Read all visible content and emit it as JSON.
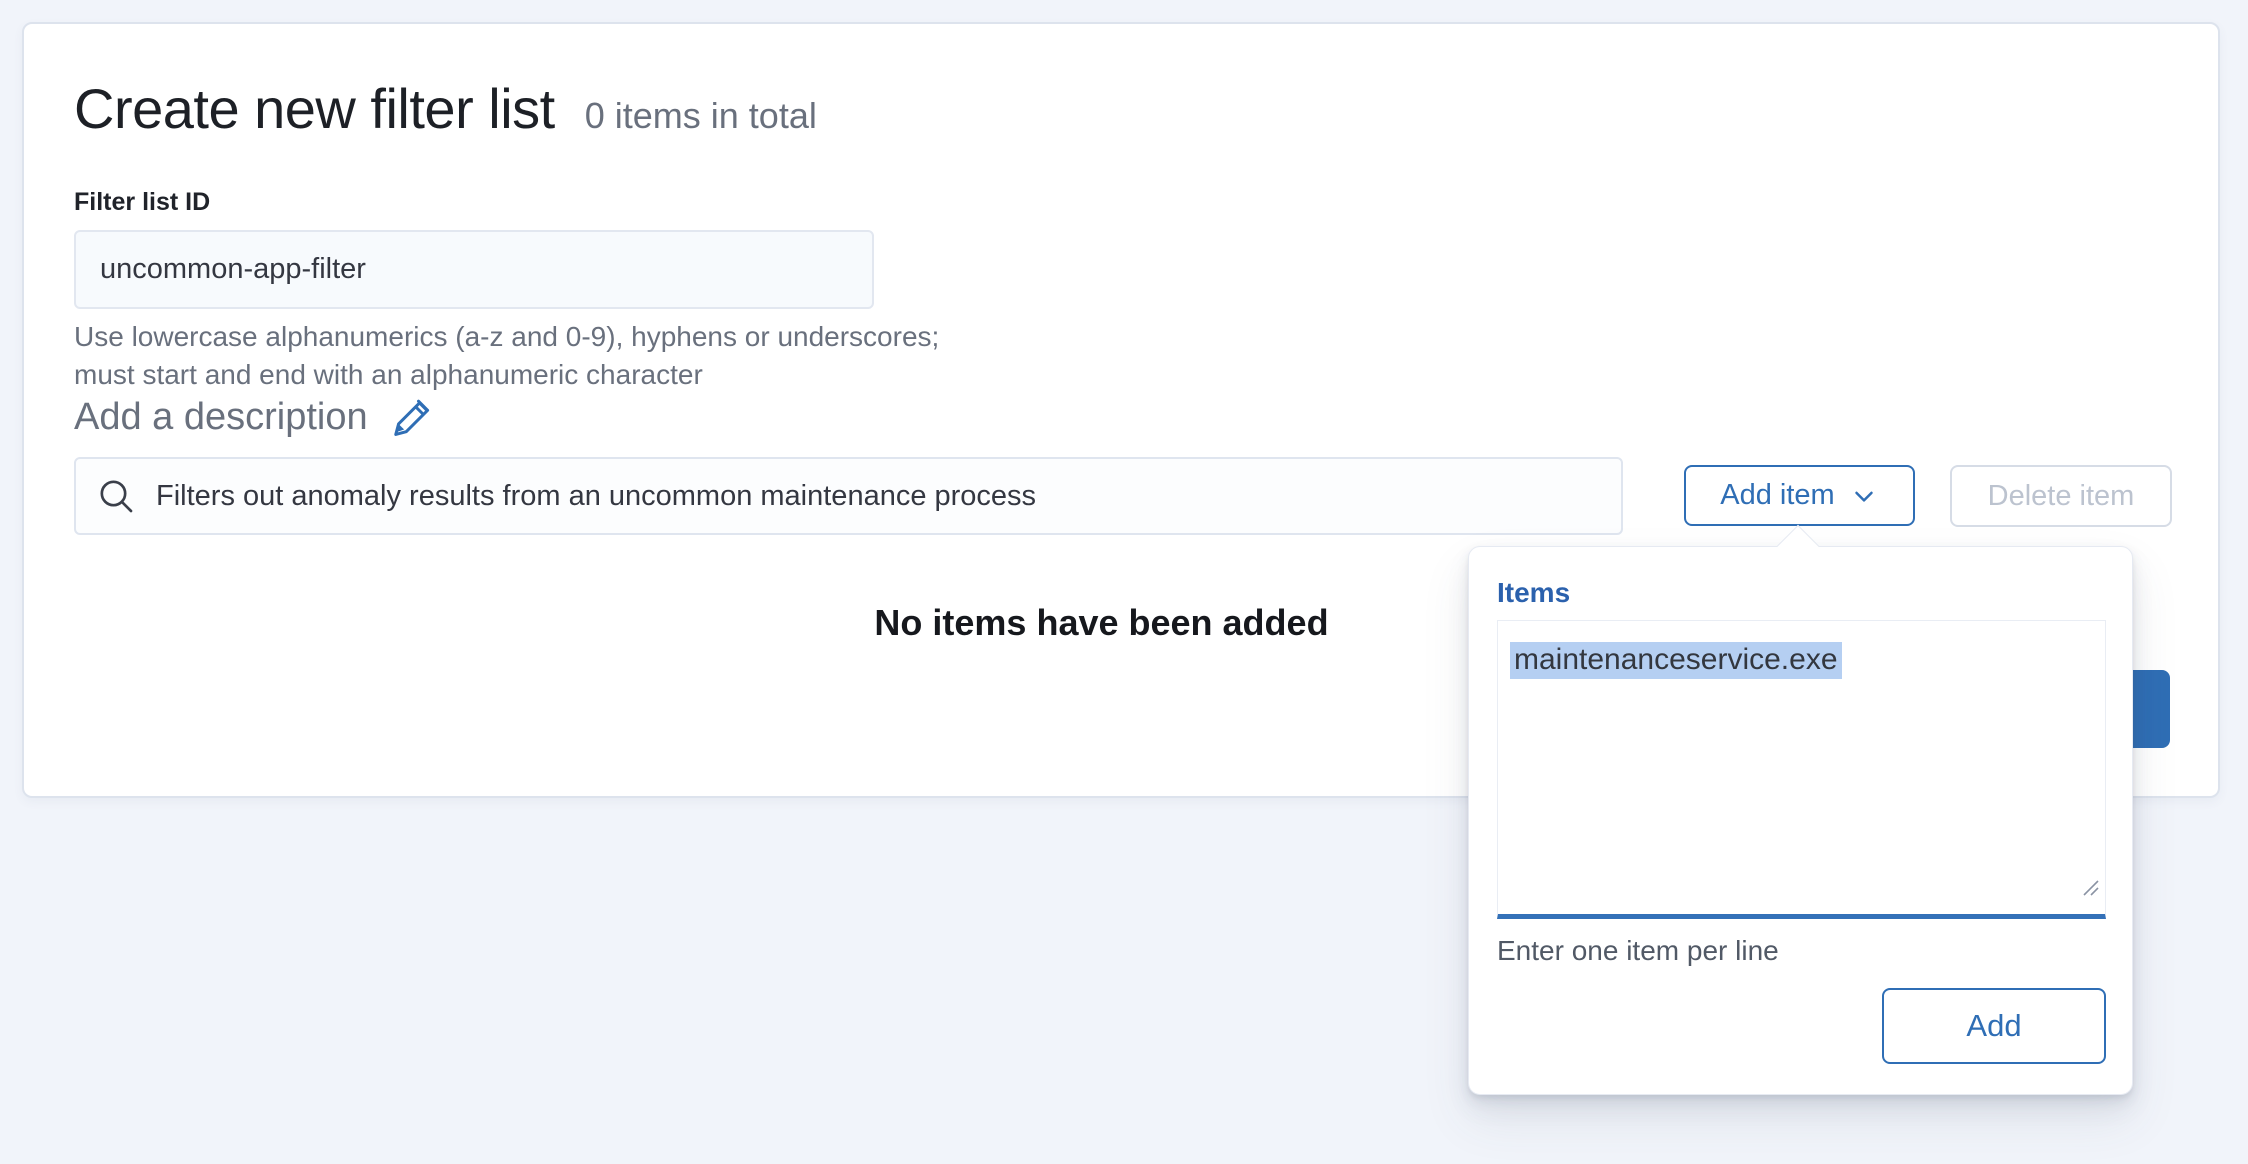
{
  "header": {
    "title": "Create new filter list",
    "items_count_text": "0 items in total"
  },
  "form": {
    "id_label": "Filter list ID",
    "id_value": "uncommon-app-filter",
    "id_help_line1": "Use lowercase alphanumerics (a-z and 0-9), hyphens or underscores;",
    "id_help_line2": "must start and end with an alphanumeric character",
    "description_link": "Add a description",
    "search_value": "Filters out anomaly results from an uncommon maintenance process"
  },
  "toolbar": {
    "add_item_label": "Add item",
    "delete_item_label": "Delete item"
  },
  "items_section": {
    "empty_message": "No items have been added"
  },
  "popover": {
    "label": "Items",
    "textarea_value": "maintenanceservice.exe",
    "help": "Enter one item per line",
    "add_button": "Add"
  },
  "icons": {
    "pencil": "pencil-edit",
    "search": "magnifier",
    "chevron": "chevron-down",
    "resize": "textarea-resize-handle"
  },
  "colors": {
    "primary_blue": "#2f6eb5",
    "selection_highlight": "#b5cff2",
    "subdued_text": "#69707d",
    "page_background": "#f1f4fa"
  }
}
